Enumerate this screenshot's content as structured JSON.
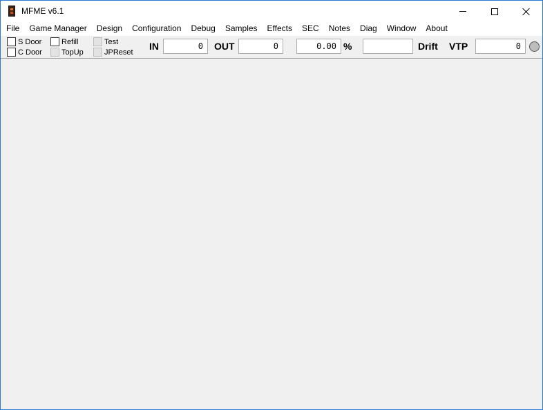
{
  "window": {
    "title": "MFME v6.1"
  },
  "menu": [
    "File",
    "Game Manager",
    "Design",
    "Configuration",
    "Debug",
    "Samples",
    "Effects",
    "SEC",
    "Notes",
    "Diag",
    "Window",
    "About"
  ],
  "toolbar": {
    "checkboxes": {
      "s_door": {
        "label": "S Door",
        "checked": false
      },
      "c_door": {
        "label": "C Door",
        "checked": false
      },
      "refill": {
        "label": "Refill",
        "checked": false
      },
      "topup": {
        "label": "TopUp",
        "checked": false,
        "disabled": true
      },
      "test": {
        "label": "Test",
        "checked": false,
        "disabled": true
      },
      "jpreset": {
        "label": "JPReset",
        "checked": false,
        "disabled": true
      }
    },
    "in_label": "IN",
    "in_value": "0",
    "out_label": "OUT",
    "out_value": "0",
    "percent_value": "0.00",
    "percent_label": "%",
    "drift_value": "",
    "drift_label": "Drift",
    "vtp_label": "VTP",
    "vtp_value": "0"
  }
}
